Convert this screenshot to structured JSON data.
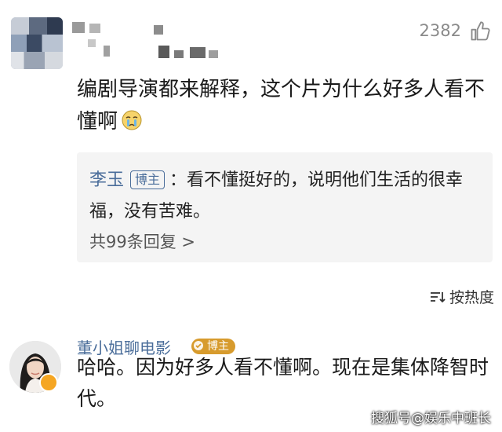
{
  "comment1": {
    "likes": "2382",
    "text": "编剧导演都来解释，这个片为什么好多人看不懂啊",
    "emoji": "crying-face-emoji",
    "reply": {
      "author": "李玉",
      "badge": "博主",
      "separator": "：",
      "text": "看不懂挺好的，说明他们生活的很幸福，没有苦难。",
      "more": "共99条回复 >"
    }
  },
  "sort": {
    "label": "按热度"
  },
  "comment2": {
    "author": "董小姐聊电影",
    "badge": "博主",
    "text": "哈哈。因为好多人看不懂啊。现在是集体降智时代。"
  },
  "watermark": "搜狐号@娱乐中班长",
  "colors": {
    "link_blue": "#4a6d9a",
    "reply_bg": "#f4f4f4",
    "badge_gold": "#d79b2d"
  }
}
